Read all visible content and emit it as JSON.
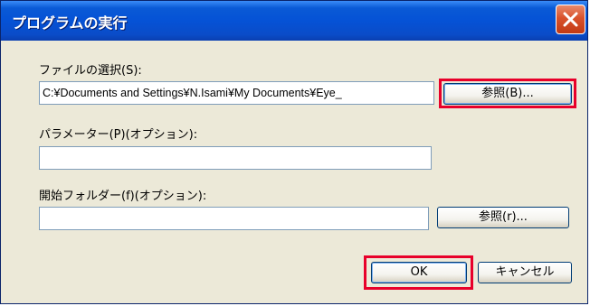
{
  "window": {
    "title": "プログラムの実行",
    "close_icon": "close-icon"
  },
  "fields": {
    "file": {
      "label": "ファイルの選択(S):",
      "value": "C:¥Documents and Settings¥N.Isami¥My Documents¥Eye_"
    },
    "params": {
      "label": "パラメーター(P)(オプション):",
      "value": ""
    },
    "start_folder": {
      "label": "開始フォルダー(f)(オプション):",
      "value": ""
    }
  },
  "buttons": {
    "browse_file": "参照(B)...",
    "browse_folder": "参照(r)...",
    "ok": "OK",
    "cancel": "キャンセル"
  },
  "colors": {
    "highlight": "#e8002a",
    "titlebar": "#0552d6"
  }
}
